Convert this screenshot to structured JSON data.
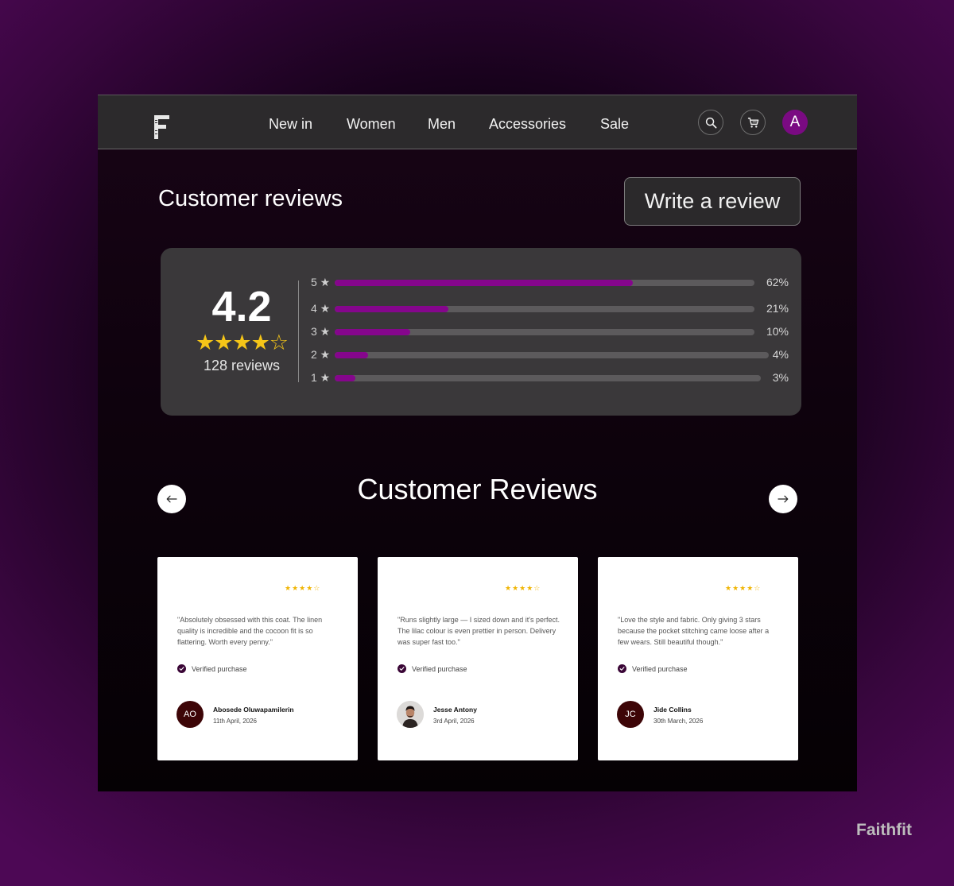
{
  "nav": {
    "links": [
      "New in",
      "Women",
      "Men",
      "Accessories",
      "Sale"
    ],
    "icons": [
      "search-icon",
      "cart-icon"
    ],
    "user_avatar": "A"
  },
  "summary": {
    "heading": "Customer reviews",
    "write_review_label": "Write a review",
    "average": "4.2",
    "stars": "★★★★",
    "stars_empty": "☆",
    "count_label": "128 reviews",
    "breakdown": [
      {
        "label": "5 ★",
        "percent_label": "62%",
        "fraction": 0.71
      },
      {
        "label": "4 ★",
        "percent_label": "21%",
        "fraction": 0.27
      },
      {
        "label": "3 ★",
        "percent_label": "10%",
        "fraction": 0.18
      },
      {
        "label": "2 ★",
        "percent_label": "4%",
        "fraction": 0.077
      },
      {
        "label": "1 ★",
        "percent_label": "3%",
        "fraction": 0.048
      }
    ]
  },
  "carousel": {
    "title": "Customer Reviews",
    "prev_icon": "arrow-left-icon",
    "next_icon": "arrow-right-icon",
    "reviews": [
      {
        "stars": "★★★★☆",
        "quote": "\"Absolutely obsessed with this coat. The linen quality is incredible and the cocoon fit is so flattering. Worth every penny.\"",
        "verified": "Verified purchase",
        "initials": "AO",
        "name": "Abosede Oluwapamilerin",
        "date": "11th April, 2026"
      },
      {
        "stars": "★★★★☆",
        "quote": "\"Runs slightly large — I sized down and it's perfect. The lilac colour is even prettier in person. Delivery was super fast too.\"",
        "verified": "Verified purchase",
        "initials": "",
        "name": "Jesse Antony",
        "date": "3rd April, 2026"
      },
      {
        "stars": "★★★★☆",
        "quote": "\"Love the style and fabric. Only giving 3 stars because the pocket stitching came loose after a few wears. Still beautiful though.\"",
        "verified": "Verified purchase",
        "initials": "JC",
        "name": "Jide Collins",
        "date": "30th March, 2026"
      }
    ]
  },
  "brand": "Faithfit",
  "colors": {
    "accent": "#85068c",
    "star": "#f5c518",
    "avatar_bg": "#3d0507"
  }
}
